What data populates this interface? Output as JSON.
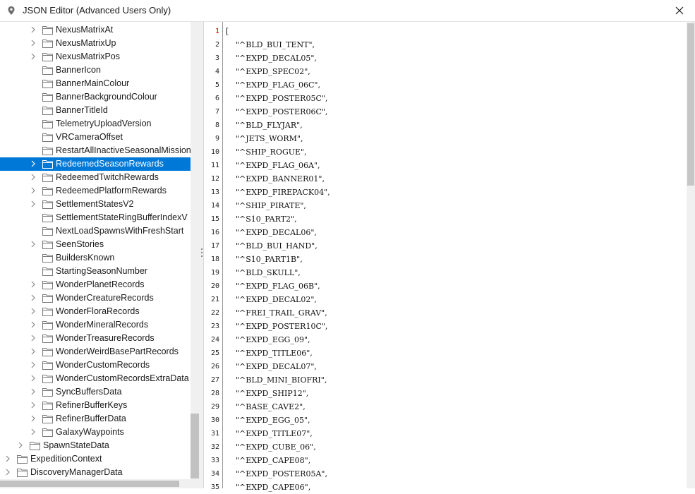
{
  "window": {
    "title": "JSON Editor (Advanced Users Only)",
    "app_icon": "location-pin-icon",
    "close_icon": "close-icon"
  },
  "colors": {
    "selection": "#0078d7",
    "current_line_number": "#d40000",
    "gutter_border": "#9a9a9a"
  },
  "tree": {
    "items": [
      {
        "label": "NexusMatrixAt",
        "level": 2,
        "expandable": true,
        "selected": false
      },
      {
        "label": "NexusMatrixUp",
        "level": 2,
        "expandable": true,
        "selected": false
      },
      {
        "label": "NexusMatrixPos",
        "level": 2,
        "expandable": true,
        "selected": false
      },
      {
        "label": "BannerIcon",
        "level": 2,
        "expandable": false,
        "selected": false
      },
      {
        "label": "BannerMainColour",
        "level": 2,
        "expandable": false,
        "selected": false
      },
      {
        "label": "BannerBackgroundColour",
        "level": 2,
        "expandable": false,
        "selected": false
      },
      {
        "label": "BannerTitleId",
        "level": 2,
        "expandable": false,
        "selected": false
      },
      {
        "label": "TelemetryUploadVersion",
        "level": 2,
        "expandable": false,
        "selected": false
      },
      {
        "label": "VRCameraOffset",
        "level": 2,
        "expandable": false,
        "selected": false
      },
      {
        "label": "RestartAllInactiveSeasonalMission",
        "level": 2,
        "expandable": false,
        "selected": false
      },
      {
        "label": "RedeemedSeasonRewards",
        "level": 2,
        "expandable": true,
        "selected": true
      },
      {
        "label": "RedeemedTwitchRewards",
        "level": 2,
        "expandable": true,
        "selected": false
      },
      {
        "label": "RedeemedPlatformRewards",
        "level": 2,
        "expandable": true,
        "selected": false
      },
      {
        "label": "SettlementStatesV2",
        "level": 2,
        "expandable": true,
        "selected": false
      },
      {
        "label": "SettlementStateRingBufferIndexV",
        "level": 2,
        "expandable": false,
        "selected": false
      },
      {
        "label": "NextLoadSpawnsWithFreshStart",
        "level": 2,
        "expandable": false,
        "selected": false
      },
      {
        "label": "SeenStories",
        "level": 2,
        "expandable": true,
        "selected": false
      },
      {
        "label": "BuildersKnown",
        "level": 2,
        "expandable": false,
        "selected": false
      },
      {
        "label": "StartingSeasonNumber",
        "level": 2,
        "expandable": false,
        "selected": false
      },
      {
        "label": "WonderPlanetRecords",
        "level": 2,
        "expandable": true,
        "selected": false
      },
      {
        "label": "WonderCreatureRecords",
        "level": 2,
        "expandable": true,
        "selected": false
      },
      {
        "label": "WonderFloraRecords",
        "level": 2,
        "expandable": true,
        "selected": false
      },
      {
        "label": "WonderMineralRecords",
        "level": 2,
        "expandable": true,
        "selected": false
      },
      {
        "label": "WonderTreasureRecords",
        "level": 2,
        "expandable": true,
        "selected": false
      },
      {
        "label": "WonderWeirdBasePartRecords",
        "level": 2,
        "expandable": true,
        "selected": false
      },
      {
        "label": "WonderCustomRecords",
        "level": 2,
        "expandable": true,
        "selected": false
      },
      {
        "label": "WonderCustomRecordsExtraData",
        "level": 2,
        "expandable": true,
        "selected": false
      },
      {
        "label": "SyncBuffersData",
        "level": 2,
        "expandable": true,
        "selected": false
      },
      {
        "label": "RefinerBufferKeys",
        "level": 2,
        "expandable": true,
        "selected": false
      },
      {
        "label": "RefinerBufferData",
        "level": 2,
        "expandable": true,
        "selected": false
      },
      {
        "label": "GalaxyWaypoints",
        "level": 2,
        "expandable": true,
        "selected": false
      },
      {
        "label": "SpawnStateData",
        "level": 1,
        "expandable": true,
        "selected": false
      },
      {
        "label": "ExpeditionContext",
        "level": 0,
        "expandable": true,
        "selected": false
      },
      {
        "label": "DiscoveryManagerData",
        "level": 0,
        "expandable": true,
        "selected": false
      }
    ]
  },
  "editor": {
    "current_line": 1,
    "lines": [
      "[",
      "    \"^BLD_BUI_TENT\",",
      "    \"^EXPD_DECAL05\",",
      "    \"^EXPD_SPEC02\",",
      "    \"^EXPD_FLAG_06C\",",
      "    \"^EXPD_POSTER05C\",",
      "    \"^EXPD_POSTER06C\",",
      "    \"^BLD_FLYJAR\",",
      "    \"^JETS_WORM\",",
      "    \"^SHIP_ROGUE\",",
      "    \"^EXPD_FLAG_06A\",",
      "    \"^EXPD_BANNER01\",",
      "    \"^EXPD_FIREPACK04\",",
      "    \"^SHIP_PIRATE\",",
      "    \"^S10_PART2\",",
      "    \"^EXPD_DECAL06\",",
      "    \"^BLD_BUI_HAND\",",
      "    \"^S10_PART1B\",",
      "    \"^BLD_SKULL\",",
      "    \"^EXPD_FLAG_06B\",",
      "    \"^EXPD_DECAL02\",",
      "    \"^FREI_TRAIL_GRAV\",",
      "    \"^EXPD_POSTER10C\",",
      "    \"^EXPD_EGG_09\",",
      "    \"^EXPD_TITLE06\",",
      "    \"^EXPD_DECAL07\",",
      "    \"^BLD_MINI_BIOFRI\",",
      "    \"^EXPD_SHIP12\",",
      "    \"^BASE_CAVE2\",",
      "    \"^EXPD_EGG_05\",",
      "    \"^EXPD_TITLE07\",",
      "    \"^EXPD_CUBE_06\",",
      "    \"^EXPD_CAPE08\",",
      "    \"^EXPD_POSTER05A\",",
      "    \"^EXPD_CAPE06\","
    ]
  }
}
